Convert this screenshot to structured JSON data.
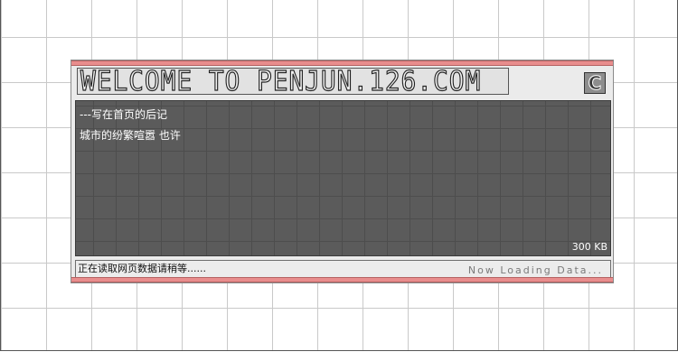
{
  "window": {
    "title": "WELCOME TO PENJUN.126.COM",
    "logo_letter": "C",
    "colors": {
      "accent_bar": "#e88d8d",
      "content_background": "#5b5b5b",
      "page_background": "#ffffff"
    }
  },
  "content": {
    "lines": [
      "---写在首页的后记",
      "城市的纷繁喧嚣 也许"
    ],
    "size_label": "300 KB"
  },
  "status": {
    "left_text": "正在读取网页数据请稍等......",
    "right_text": "Now Loading Data..."
  },
  "icons": {
    "logo": "c-logo-icon"
  }
}
